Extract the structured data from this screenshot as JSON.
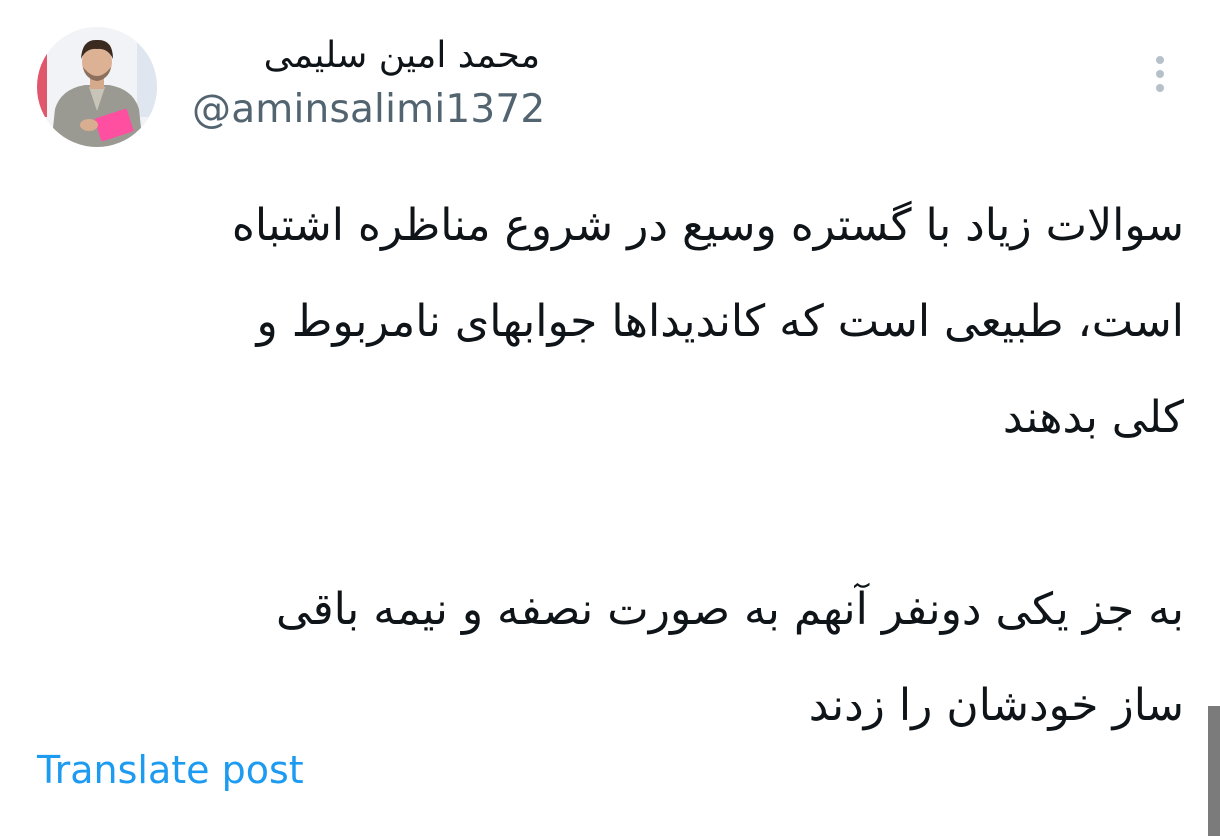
{
  "author": {
    "display_name": "محمد امین سلیمی",
    "handle": "@aminsalimi1372",
    "avatar_icon": "profile-photo"
  },
  "post": {
    "paragraphs": [
      {
        "lines": [
          "سوالات زیاد با گستره وسیع در شروع مناظره اشتباه",
          "است، طبیعی است که کاندیداها جوابهای نامربوط و",
          "کلی بدهند"
        ]
      },
      {
        "lines": [
          "به جز یکی دونفر آنهم به صورت نصفه و نیمه باقی",
          "ساز خودشان را زدند"
        ]
      }
    ]
  },
  "actions": {
    "translate_label": "Translate post",
    "more_icon": "more-vertical-icon"
  },
  "colors": {
    "text": "#0f1419",
    "secondary": "#536471",
    "link": "#1d9bf0",
    "more_dots": "#b6c0c8",
    "scrollbar": "#7b7b7b"
  }
}
